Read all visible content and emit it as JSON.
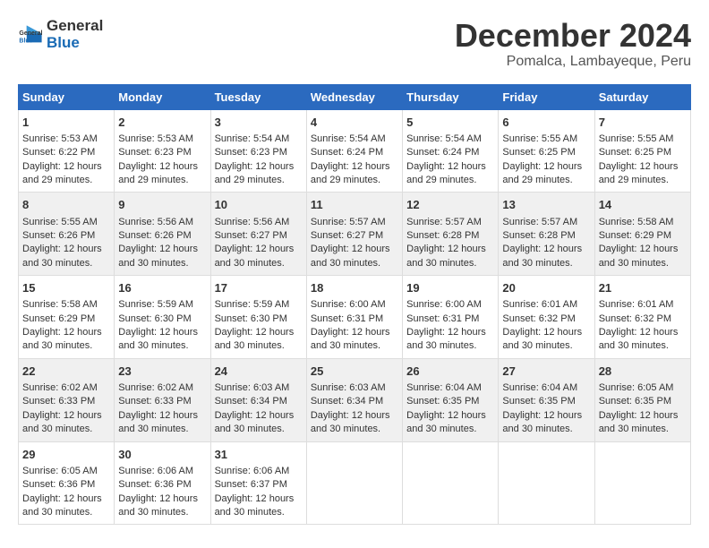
{
  "header": {
    "logo_line1": "General",
    "logo_line2": "Blue",
    "month_title": "December 2024",
    "location": "Pomalca, Lambayeque, Peru"
  },
  "columns": [
    "Sunday",
    "Monday",
    "Tuesday",
    "Wednesday",
    "Thursday",
    "Friday",
    "Saturday"
  ],
  "weeks": [
    [
      {
        "day": "1",
        "info": "Sunrise: 5:53 AM\nSunset: 6:22 PM\nDaylight: 12 hours\nand 29 minutes."
      },
      {
        "day": "2",
        "info": "Sunrise: 5:53 AM\nSunset: 6:23 PM\nDaylight: 12 hours\nand 29 minutes."
      },
      {
        "day": "3",
        "info": "Sunrise: 5:54 AM\nSunset: 6:23 PM\nDaylight: 12 hours\nand 29 minutes."
      },
      {
        "day": "4",
        "info": "Sunrise: 5:54 AM\nSunset: 6:24 PM\nDaylight: 12 hours\nand 29 minutes."
      },
      {
        "day": "5",
        "info": "Sunrise: 5:54 AM\nSunset: 6:24 PM\nDaylight: 12 hours\nand 29 minutes."
      },
      {
        "day": "6",
        "info": "Sunrise: 5:55 AM\nSunset: 6:25 PM\nDaylight: 12 hours\nand 29 minutes."
      },
      {
        "day": "7",
        "info": "Sunrise: 5:55 AM\nSunset: 6:25 PM\nDaylight: 12 hours\nand 29 minutes."
      }
    ],
    [
      {
        "day": "8",
        "info": "Sunrise: 5:55 AM\nSunset: 6:26 PM\nDaylight: 12 hours\nand 30 minutes."
      },
      {
        "day": "9",
        "info": "Sunrise: 5:56 AM\nSunset: 6:26 PM\nDaylight: 12 hours\nand 30 minutes."
      },
      {
        "day": "10",
        "info": "Sunrise: 5:56 AM\nSunset: 6:27 PM\nDaylight: 12 hours\nand 30 minutes."
      },
      {
        "day": "11",
        "info": "Sunrise: 5:57 AM\nSunset: 6:27 PM\nDaylight: 12 hours\nand 30 minutes."
      },
      {
        "day": "12",
        "info": "Sunrise: 5:57 AM\nSunset: 6:28 PM\nDaylight: 12 hours\nand 30 minutes."
      },
      {
        "day": "13",
        "info": "Sunrise: 5:57 AM\nSunset: 6:28 PM\nDaylight: 12 hours\nand 30 minutes."
      },
      {
        "day": "14",
        "info": "Sunrise: 5:58 AM\nSunset: 6:29 PM\nDaylight: 12 hours\nand 30 minutes."
      }
    ],
    [
      {
        "day": "15",
        "info": "Sunrise: 5:58 AM\nSunset: 6:29 PM\nDaylight: 12 hours\nand 30 minutes."
      },
      {
        "day": "16",
        "info": "Sunrise: 5:59 AM\nSunset: 6:30 PM\nDaylight: 12 hours\nand 30 minutes."
      },
      {
        "day": "17",
        "info": "Sunrise: 5:59 AM\nSunset: 6:30 PM\nDaylight: 12 hours\nand 30 minutes."
      },
      {
        "day": "18",
        "info": "Sunrise: 6:00 AM\nSunset: 6:31 PM\nDaylight: 12 hours\nand 30 minutes."
      },
      {
        "day": "19",
        "info": "Sunrise: 6:00 AM\nSunset: 6:31 PM\nDaylight: 12 hours\nand 30 minutes."
      },
      {
        "day": "20",
        "info": "Sunrise: 6:01 AM\nSunset: 6:32 PM\nDaylight: 12 hours\nand 30 minutes."
      },
      {
        "day": "21",
        "info": "Sunrise: 6:01 AM\nSunset: 6:32 PM\nDaylight: 12 hours\nand 30 minutes."
      }
    ],
    [
      {
        "day": "22",
        "info": "Sunrise: 6:02 AM\nSunset: 6:33 PM\nDaylight: 12 hours\nand 30 minutes."
      },
      {
        "day": "23",
        "info": "Sunrise: 6:02 AM\nSunset: 6:33 PM\nDaylight: 12 hours\nand 30 minutes."
      },
      {
        "day": "24",
        "info": "Sunrise: 6:03 AM\nSunset: 6:34 PM\nDaylight: 12 hours\nand 30 minutes."
      },
      {
        "day": "25",
        "info": "Sunrise: 6:03 AM\nSunset: 6:34 PM\nDaylight: 12 hours\nand 30 minutes."
      },
      {
        "day": "26",
        "info": "Sunrise: 6:04 AM\nSunset: 6:35 PM\nDaylight: 12 hours\nand 30 minutes."
      },
      {
        "day": "27",
        "info": "Sunrise: 6:04 AM\nSunset: 6:35 PM\nDaylight: 12 hours\nand 30 minutes."
      },
      {
        "day": "28",
        "info": "Sunrise: 6:05 AM\nSunset: 6:35 PM\nDaylight: 12 hours\nand 30 minutes."
      }
    ],
    [
      {
        "day": "29",
        "info": "Sunrise: 6:05 AM\nSunset: 6:36 PM\nDaylight: 12 hours\nand 30 minutes."
      },
      {
        "day": "30",
        "info": "Sunrise: 6:06 AM\nSunset: 6:36 PM\nDaylight: 12 hours\nand 30 minutes."
      },
      {
        "day": "31",
        "info": "Sunrise: 6:06 AM\nSunset: 6:37 PM\nDaylight: 12 hours\nand 30 minutes."
      },
      {
        "day": "",
        "info": ""
      },
      {
        "day": "",
        "info": ""
      },
      {
        "day": "",
        "info": ""
      },
      {
        "day": "",
        "info": ""
      }
    ]
  ]
}
